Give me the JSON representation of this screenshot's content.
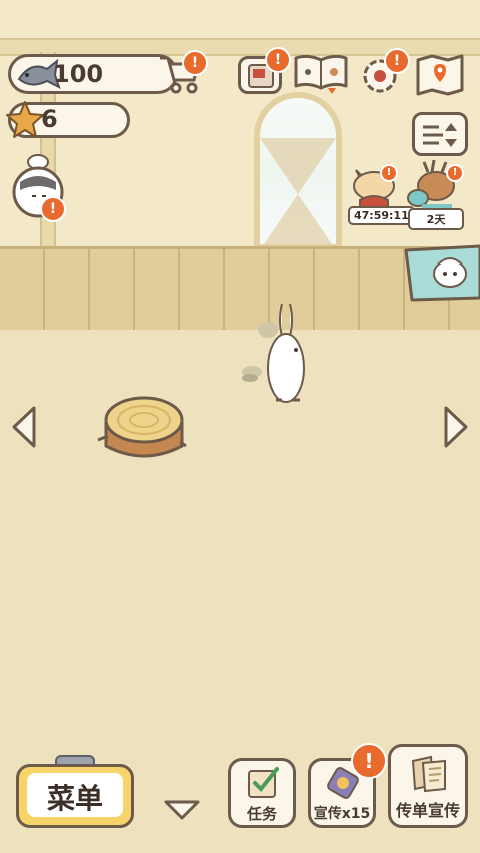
{
  "currency": {
    "fish": {
      "value": "100",
      "icon": "fish-icon"
    },
    "star": {
      "value": "6",
      "icon": "star-icon"
    }
  },
  "top_icons": [
    {
      "name": "shop-cart-icon",
      "has_alert": true
    },
    {
      "name": "notebook-icon",
      "has_alert": true
    },
    {
      "name": "paw-book-icon",
      "has_alert": false
    },
    {
      "name": "settings-gear-icon",
      "has_alert": true
    },
    {
      "name": "map-icon",
      "has_alert": false
    }
  ],
  "visitors": [
    {
      "name": "cat-visitor",
      "timer": "47:59:11"
    },
    {
      "name": "deer-visitor",
      "timer": "2天"
    }
  ],
  "alert_mark": "!",
  "bottom": {
    "menu_label": "菜单",
    "task_label": "任务",
    "promote_label": "宣传x15",
    "flyer_label": "传单宣传"
  },
  "colors": {
    "background": "#ece0b8",
    "outline": "#6d5a4a",
    "alert": "#e86a2c",
    "menu_button": "#f6d46a",
    "banner": "#a9dcd6"
  }
}
